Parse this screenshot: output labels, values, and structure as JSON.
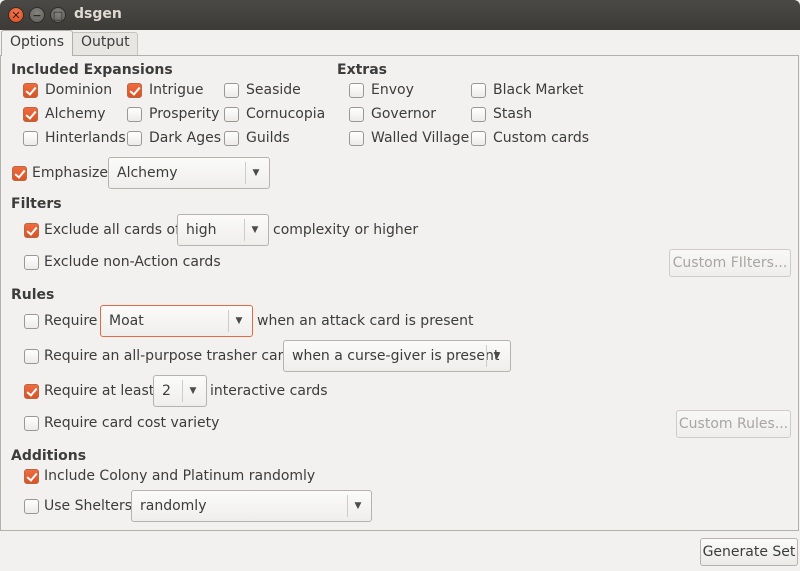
{
  "window": {
    "title": "dsgen",
    "close_glyph": "✕",
    "min_glyph": "−",
    "max_glyph": "□"
  },
  "tabs": [
    {
      "label": "Options"
    },
    {
      "label": "Output"
    }
  ],
  "included_expansions": {
    "heading": "Included Expansions",
    "items": [
      {
        "label": "Dominion",
        "checked": true
      },
      {
        "label": "Intrigue",
        "checked": true
      },
      {
        "label": "Seaside",
        "checked": false
      },
      {
        "label": "Alchemy",
        "checked": true
      },
      {
        "label": "Prosperity",
        "checked": false
      },
      {
        "label": "Cornucopia",
        "checked": false
      },
      {
        "label": "Hinterlands",
        "checked": false
      },
      {
        "label": "Dark Ages",
        "checked": false
      },
      {
        "label": "Guilds",
        "checked": false
      }
    ]
  },
  "extras": {
    "heading": "Extras",
    "items": [
      {
        "label": "Envoy",
        "checked": false
      },
      {
        "label": "Black Market",
        "checked": false
      },
      {
        "label": "Governor",
        "checked": false
      },
      {
        "label": "Stash",
        "checked": false
      },
      {
        "label": "Walled Village",
        "checked": false
      },
      {
        "label": "Custom cards",
        "checked": false
      }
    ]
  },
  "emphasize": {
    "label": "Emphasize",
    "checked": true,
    "value": "Alchemy"
  },
  "filters": {
    "heading": "Filters",
    "exclude_complexity": {
      "label_before": "Exclude all cards of",
      "value": "high",
      "label_after": "complexity or higher",
      "checked": true
    },
    "exclude_non_action": {
      "label": "Exclude non-Action cards",
      "checked": false
    },
    "custom_button": "Custom FIlters..."
  },
  "rules": {
    "heading": "Rules",
    "require_attack": {
      "label_before": "Require",
      "value": "Moat",
      "label_after": "when an attack card is present",
      "checked": false
    },
    "require_trasher": {
      "label": "Require an all-purpose trasher card",
      "value": "when a curse-giver is present",
      "checked": false
    },
    "require_interactive": {
      "label_before": "Require at least",
      "value": "2",
      "label_after": "interactive cards",
      "checked": true
    },
    "require_cost_variety": {
      "label": "Require card cost variety",
      "checked": false
    },
    "custom_button": "Custom Rules..."
  },
  "additions": {
    "heading": "Additions",
    "colony_platinum": {
      "label": "Include Colony and Platinum randomly",
      "checked": true
    },
    "shelters": {
      "label": "Use Shelters",
      "value": "randomly",
      "checked": false
    }
  },
  "generate_button": "Generate Set",
  "icons": {
    "dropdown": "▼"
  },
  "colors": {
    "accent": "#e26b45",
    "titlebar": "#3c3b37",
    "background": "#f2f1f0"
  }
}
